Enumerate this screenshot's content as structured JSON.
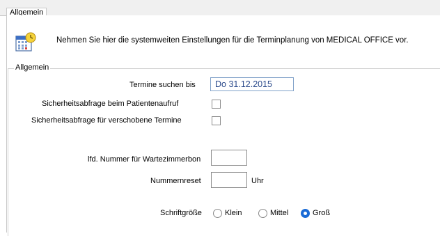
{
  "tabs": [
    {
      "label": "Allgemein"
    }
  ],
  "intro": {
    "text": "Nehmen Sie hier die systemweiten Einstellungen für die Terminplanung von MEDICAL OFFICE vor."
  },
  "group": {
    "title": "Allgemein"
  },
  "fields": {
    "search_until": {
      "label": "Termine suchen bis",
      "value": "Do 31.12.2015"
    },
    "confirm_patient_call": {
      "label": "Sicherheitsabfrage beim Patientenaufruf",
      "checked": false
    },
    "confirm_moved_appts": {
      "label": "Sicherheitsabfrage für verschobene Termine",
      "checked": false
    },
    "waiting_room_number": {
      "label": "lfd. Nummer für Wartezimmerbon",
      "value": ""
    },
    "number_reset": {
      "label": "Nummernreset",
      "value": "",
      "unit": "Uhr"
    }
  },
  "font_size": {
    "label": "Schriftgröße",
    "options": [
      "Klein",
      "Mittel",
      "Groß"
    ],
    "selected": "Groß"
  },
  "colors": {
    "accent": "#1a6bd6",
    "date_text": "#2b4a8b"
  },
  "icons": {
    "intro": "calendar-clock-icon"
  }
}
